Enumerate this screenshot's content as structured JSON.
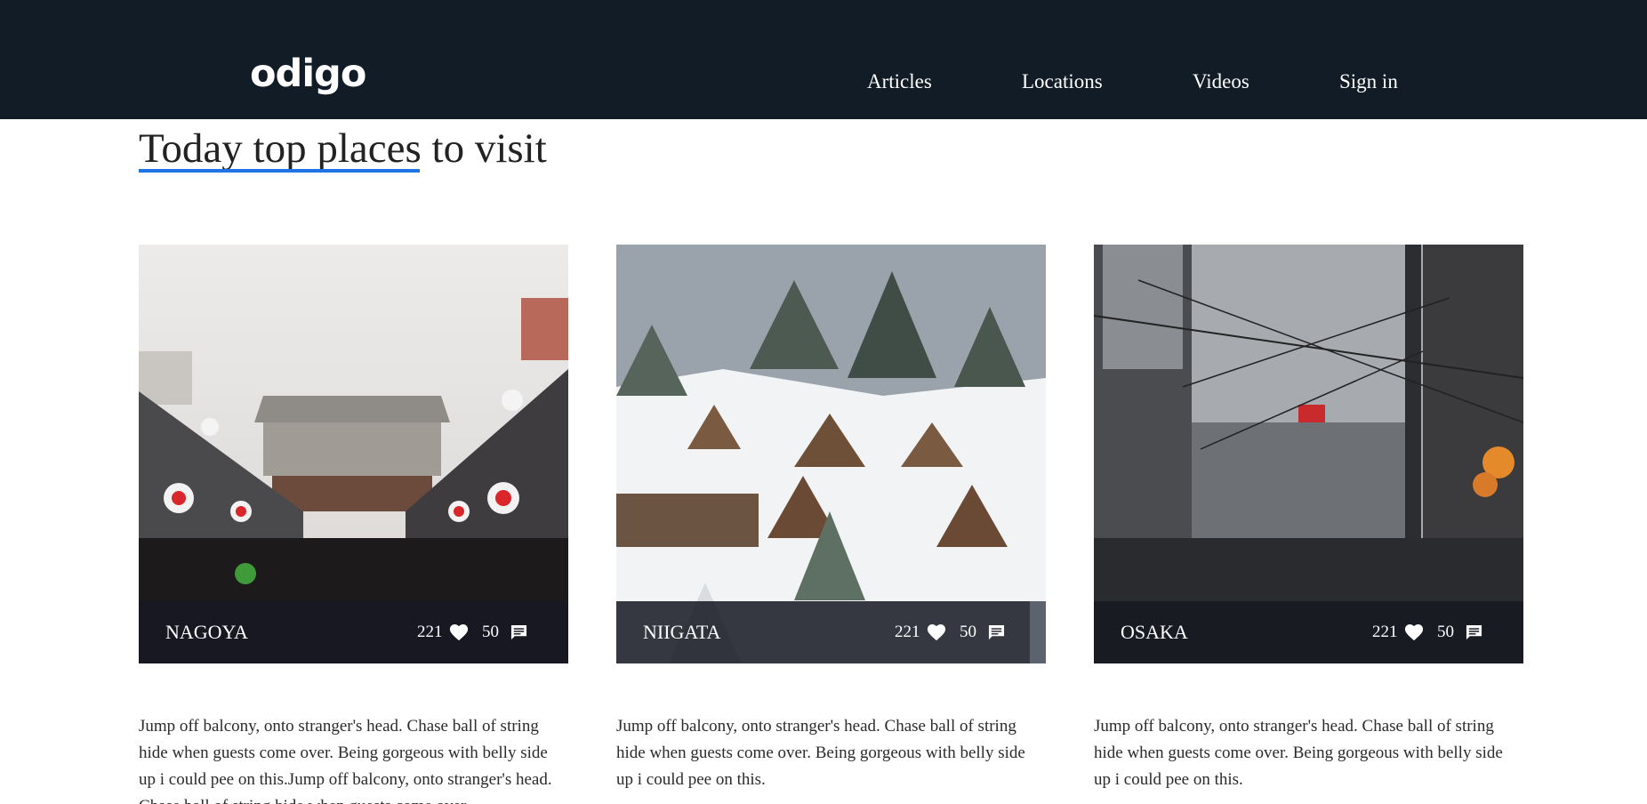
{
  "header": {
    "logo": "odigo",
    "nav": {
      "articles": "Articles",
      "locations": "Locations",
      "videos": "Videos",
      "sign_in": "Sign in"
    },
    "background": "#111c26"
  },
  "section": {
    "title": "Today top places to visit",
    "accent": "#1f73e5"
  },
  "cards": [
    {
      "city": "NAGOYA",
      "likes": "221",
      "comments": "50",
      "description": "Jump off balcony, onto stranger's head. Chase ball of string hide when guests come over. Being gorgeous with belly side up i could pee on this.Jump off balcony, onto stranger's head. Chase ball of string hide when guests come over."
    },
    {
      "city": "NIIGATA",
      "likes": "221",
      "comments": "50",
      "description": "Jump off balcony, onto stranger's head. Chase ball of string hide when guests come over. Being gorgeous with belly side up i could pee on this."
    },
    {
      "city": "OSAKA",
      "likes": "221",
      "comments": "50",
      "description": "Jump off balcony, onto stranger's head. Chase ball of string hide when guests come over. Being gorgeous with belly side up i could pee on this."
    }
  ],
  "icons": {
    "likes": "heart-icon",
    "comments": "comment-icon"
  }
}
